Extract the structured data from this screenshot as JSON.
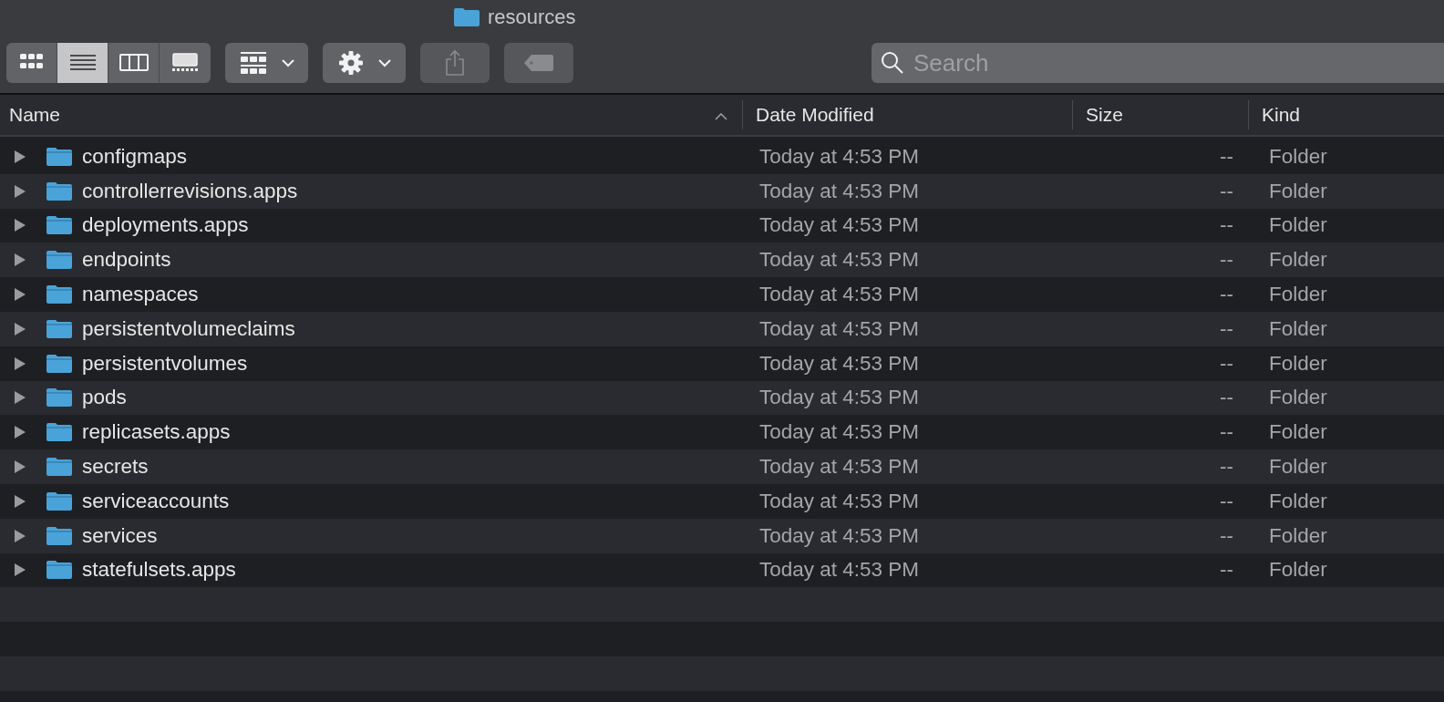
{
  "window": {
    "title": "resources"
  },
  "toolbar": {
    "view_modes": [
      {
        "kind": "icons",
        "selected": false
      },
      {
        "kind": "list",
        "selected": true
      },
      {
        "kind": "columns",
        "selected": false
      },
      {
        "kind": "gallery",
        "selected": false
      }
    ],
    "search": {
      "placeholder": "Search"
    }
  },
  "table": {
    "columns": [
      {
        "label": "Name",
        "sorted": true
      },
      {
        "label": "Date Modified",
        "sorted": false
      },
      {
        "label": "Size",
        "sorted": false
      },
      {
        "label": "Kind",
        "sorted": false
      }
    ],
    "rows": [
      {
        "name": "configmaps",
        "date": "Today at 4:53 PM",
        "size": "--",
        "kind": "Folder",
        "expanded": false
      },
      {
        "name": "controllerrevisions.apps",
        "date": "Today at 4:53 PM",
        "size": "--",
        "kind": "Folder",
        "expanded": false
      },
      {
        "name": "deployments.apps",
        "date": "Today at 4:53 PM",
        "size": "--",
        "kind": "Folder",
        "expanded": false
      },
      {
        "name": "endpoints",
        "date": "Today at 4:53 PM",
        "size": "--",
        "kind": "Folder",
        "expanded": false
      },
      {
        "name": "namespaces",
        "date": "Today at 4:53 PM",
        "size": "--",
        "kind": "Folder",
        "expanded": false
      },
      {
        "name": "persistentvolumeclaims",
        "date": "Today at 4:53 PM",
        "size": "--",
        "kind": "Folder",
        "expanded": false
      },
      {
        "name": "persistentvolumes",
        "date": "Today at 4:53 PM",
        "size": "--",
        "kind": "Folder",
        "expanded": false
      },
      {
        "name": "pods",
        "date": "Today at 4:53 PM",
        "size": "--",
        "kind": "Folder",
        "expanded": false
      },
      {
        "name": "replicasets.apps",
        "date": "Today at 4:53 PM",
        "size": "--",
        "kind": "Folder",
        "expanded": false
      },
      {
        "name": "secrets",
        "date": "Today at 4:53 PM",
        "size": "--",
        "kind": "Folder",
        "expanded": false
      },
      {
        "name": "serviceaccounts",
        "date": "Today at 4:53 PM",
        "size": "--",
        "kind": "Folder",
        "expanded": false
      },
      {
        "name": "services",
        "date": "Today at 4:53 PM",
        "size": "--",
        "kind": "Folder",
        "expanded": false
      },
      {
        "name": "statefulsets.apps",
        "date": "Today at 4:53 PM",
        "size": "--",
        "kind": "Folder",
        "expanded": false
      }
    ]
  }
}
